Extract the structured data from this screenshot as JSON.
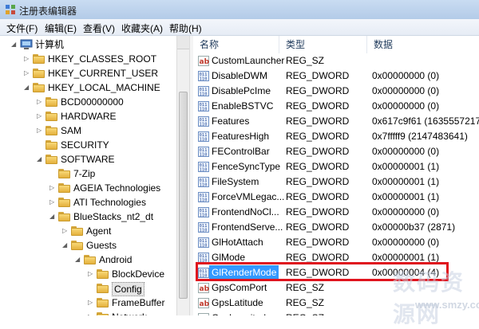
{
  "window": {
    "title": "注册表编辑器"
  },
  "menu": [
    "文件(F)",
    "编辑(E)",
    "查看(V)",
    "收藏夹(A)",
    "帮助(H)"
  ],
  "tree": [
    {
      "label": "计算机",
      "depth": 0,
      "expanded": true,
      "icon": "computer"
    },
    {
      "label": "HKEY_CLASSES_ROOT",
      "depth": 1,
      "expanded": false
    },
    {
      "label": "HKEY_CURRENT_USER",
      "depth": 1,
      "expanded": false
    },
    {
      "label": "HKEY_LOCAL_MACHINE",
      "depth": 1,
      "expanded": true
    },
    {
      "label": "BCD00000000",
      "depth": 2,
      "expanded": false
    },
    {
      "label": "HARDWARE",
      "depth": 2,
      "expanded": false
    },
    {
      "label": "SAM",
      "depth": 2,
      "expanded": false
    },
    {
      "label": "SECURITY",
      "depth": 2,
      "expanded": null
    },
    {
      "label": "SOFTWARE",
      "depth": 2,
      "expanded": true
    },
    {
      "label": "7-Zip",
      "depth": 3,
      "expanded": null
    },
    {
      "label": "AGEIA Technologies",
      "depth": 3,
      "expanded": false
    },
    {
      "label": "ATI Technologies",
      "depth": 3,
      "expanded": false
    },
    {
      "label": "BlueStacks_nt2_dt",
      "depth": 3,
      "expanded": true
    },
    {
      "label": "Agent",
      "depth": 4,
      "expanded": false
    },
    {
      "label": "Guests",
      "depth": 4,
      "expanded": true
    },
    {
      "label": "Android",
      "depth": 5,
      "expanded": true
    },
    {
      "label": "BlockDevice",
      "depth": 6,
      "expanded": false
    },
    {
      "label": "Config",
      "depth": 6,
      "expanded": null,
      "selected": true
    },
    {
      "label": "FrameBuffer",
      "depth": 6,
      "expanded": false
    },
    {
      "label": "Network",
      "depth": 6,
      "expanded": false
    }
  ],
  "columns": {
    "name": "名称",
    "type": "类型",
    "data": "数据"
  },
  "values": [
    {
      "name": "CustomLauncher",
      "type": "REG_SZ",
      "data": "",
      "kind": "sz"
    },
    {
      "name": "DisableDWM",
      "type": "REG_DWORD",
      "data": "0x00000000 (0)",
      "kind": "dword"
    },
    {
      "name": "DisablePcIme",
      "type": "REG_DWORD",
      "data": "0x00000000 (0)",
      "kind": "dword"
    },
    {
      "name": "EnableBSTVC",
      "type": "REG_DWORD",
      "data": "0x00000000 (0)",
      "kind": "dword"
    },
    {
      "name": "Features",
      "type": "REG_DWORD",
      "data": "0x617c9f61 (1635557217)",
      "kind": "dword"
    },
    {
      "name": "FeaturesHigh",
      "type": "REG_DWORD",
      "data": "0x7fffff9 (2147483641)",
      "kind": "dword"
    },
    {
      "name": "FEControlBar",
      "type": "REG_DWORD",
      "data": "0x00000000 (0)",
      "kind": "dword"
    },
    {
      "name": "FenceSyncType",
      "type": "REG_DWORD",
      "data": "0x00000001 (1)",
      "kind": "dword"
    },
    {
      "name": "FileSystem",
      "type": "REG_DWORD",
      "data": "0x00000001 (1)",
      "kind": "dword"
    },
    {
      "name": "ForceVMLegac...",
      "type": "REG_DWORD",
      "data": "0x00000001 (1)",
      "kind": "dword"
    },
    {
      "name": "FrontendNoCl...",
      "type": "REG_DWORD",
      "data": "0x00000000 (0)",
      "kind": "dword"
    },
    {
      "name": "FrontendServe...",
      "type": "REG_DWORD",
      "data": "0x00000b37 (2871)",
      "kind": "dword"
    },
    {
      "name": "GlHotAttach",
      "type": "REG_DWORD",
      "data": "0x00000000 (0)",
      "kind": "dword"
    },
    {
      "name": "GlMode",
      "type": "REG_DWORD",
      "data": "0x00000001 (1)",
      "kind": "dword"
    },
    {
      "name": "GlRenderMode",
      "type": "REG_DWORD",
      "data": "0x00000004 (4)",
      "kind": "dword",
      "selected": true
    },
    {
      "name": "GpsComPort",
      "type": "REG_SZ",
      "data": "",
      "kind": "sz"
    },
    {
      "name": "GpsLatitude",
      "type": "REG_SZ",
      "data": "",
      "kind": "sz"
    },
    {
      "name": "GpsLongitude",
      "type": "REG_SZ",
      "data": "",
      "kind": "sz"
    }
  ],
  "watermark": {
    "text": "数码资源网",
    "url": "www.smzy.com"
  },
  "colors": {
    "selection": "#3399ff",
    "highlight_box": "#e0141e",
    "folder": "#f1c552"
  }
}
